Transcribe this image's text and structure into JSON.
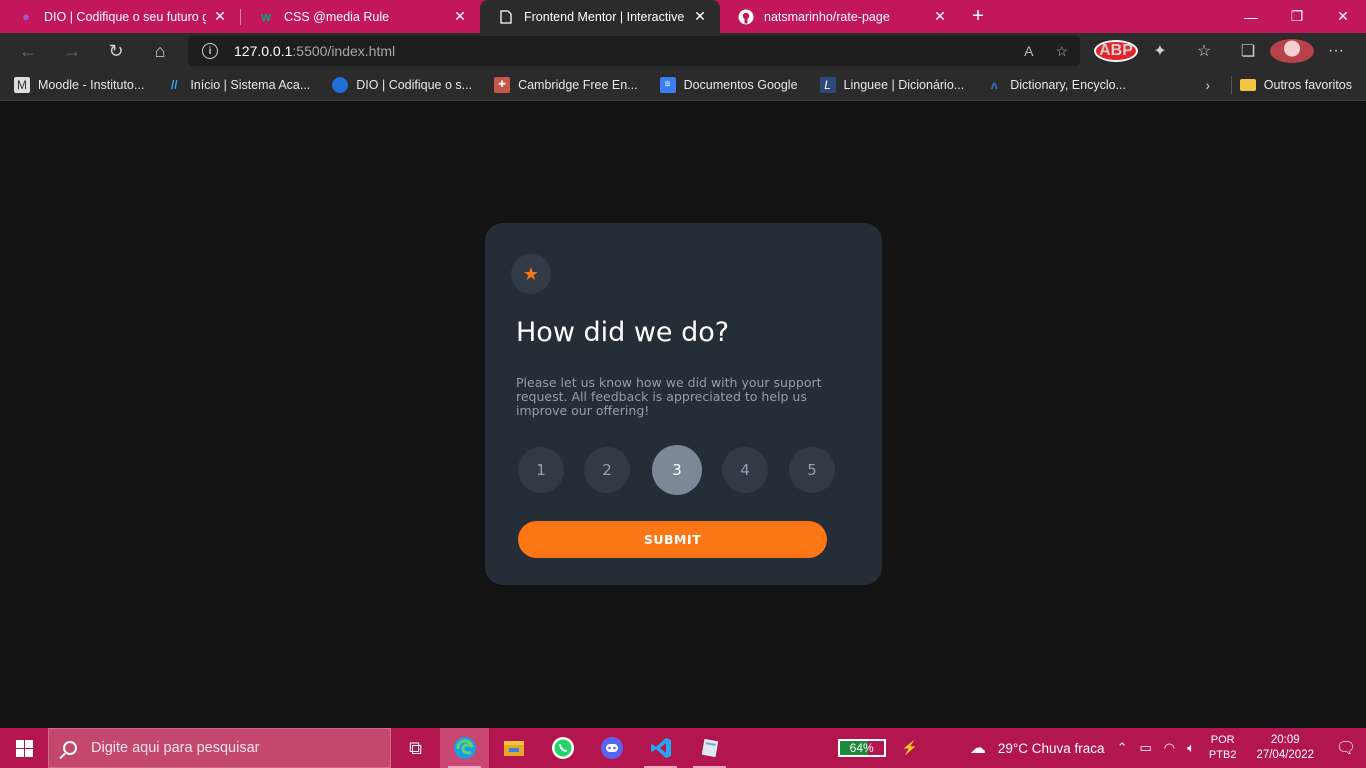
{
  "browser": {
    "tabs": [
      {
        "title": "DIO | Codifique o seu futuro global",
        "icon": "dio-icon",
        "active": false
      },
      {
        "title": "CSS @media Rule",
        "icon": "w3schools-icon",
        "active": false
      },
      {
        "title": "Frontend Mentor | Interactive rating",
        "icon": "page-icon",
        "active": true
      },
      {
        "title": "natsmarinho/rate-page",
        "icon": "github-icon",
        "active": false
      }
    ],
    "close_glyph": "✕",
    "new_tab_glyph": "+",
    "address": {
      "host": "127.0.0.1",
      "path": ":5500/index.html"
    },
    "bookmarks": [
      {
        "label": "Moodle - Instituto...",
        "icon": "moodle-icon",
        "color": "#dddddd"
      },
      {
        "label": "Início | Sistema Aca...",
        "icon": "slash-icon",
        "color": "#2fa8e0"
      },
      {
        "label": "DIO | Codifique o s...",
        "icon": "dio-drop-icon",
        "color": "#1f6fd6"
      },
      {
        "label": "Cambridge Free En...",
        "icon": "cambridge-icon",
        "color": "#c9564a"
      },
      {
        "label": "Documentos Google",
        "icon": "google-docs-icon",
        "color": "#3a7ef2"
      },
      {
        "label": "Linguee | Dicionário...",
        "icon": "linguee-icon",
        "color": "#2d4a7a"
      },
      {
        "label": "Dictionary, Encyclo...",
        "icon": "dictionary-icon",
        "color": "#2e6fc4"
      }
    ],
    "other_favorites": "Outros favoritos"
  },
  "card": {
    "title": "How did we do?",
    "description": "Please let us know how we did with your support request. All feedback is appreciated to help us improve our offering!",
    "ratings": [
      "1",
      "2",
      "3",
      "4",
      "5"
    ],
    "selected_rating": "3",
    "submit_label": "SUBMIT",
    "accent_color": "#fc7614"
  },
  "taskbar": {
    "search_placeholder": "Digite aqui para pesquisar",
    "battery": "64%",
    "battery_level": 0.64,
    "weather": "29°C  Chuva fraca",
    "lang_top": "POR",
    "lang_bottom": "PTB2",
    "time": "20:09",
    "date": "27/04/2022"
  }
}
